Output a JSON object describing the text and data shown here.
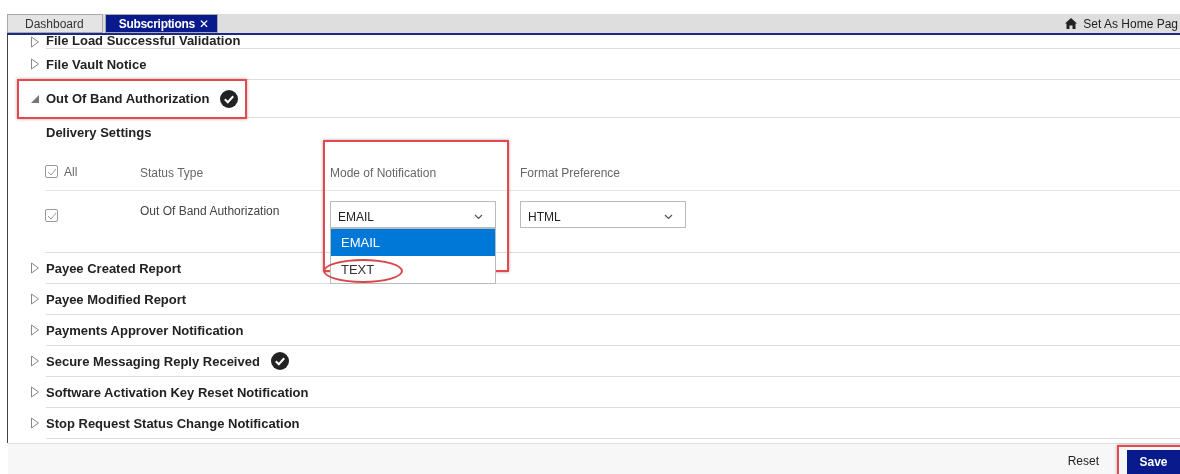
{
  "tabs": [
    {
      "label": "Dashboard",
      "selected": false
    },
    {
      "label": "Subscriptions",
      "selected": true,
      "close": "✕"
    }
  ],
  "set_home": "Set As Home Pag",
  "subscriptions": [
    {
      "name": "File Load Successful Validation",
      "expanded": false,
      "subscribed": false
    },
    {
      "name": "File Vault Notice",
      "expanded": false,
      "subscribed": false
    },
    {
      "name": "Out Of Band Authorization",
      "expanded": true,
      "subscribed": true,
      "highlighted": true,
      "details": {
        "title": "Delivery Settings",
        "all_label": "All",
        "all_checked": true,
        "columns": [
          "Status Type",
          "Mode of Notification",
          "Format Preference"
        ],
        "rows": [
          {
            "checked": true,
            "status_type": "Out Of Band Authorization",
            "mode": {
              "value": "EMAIL",
              "open": true,
              "options": [
                {
                  "label": "EMAIL",
                  "selected": true,
                  "circled": false
                },
                {
                  "label": "TEXT",
                  "selected": false,
                  "circled": true
                }
              ]
            },
            "format": {
              "value": "HTML"
            }
          }
        ]
      }
    },
    {
      "name": "Payee Created Report",
      "expanded": false,
      "subscribed": false
    },
    {
      "name": "Payee Modified Report",
      "expanded": false,
      "subscribed": false
    },
    {
      "name": "Payments Approver Notification",
      "expanded": false,
      "subscribed": false
    },
    {
      "name": "Secure Messaging Reply Received",
      "expanded": false,
      "subscribed": true
    },
    {
      "name": "Software Activation Key Reset Notification",
      "expanded": false,
      "subscribed": false
    },
    {
      "name": "Stop Request Status Change Notification",
      "expanded": false,
      "subscribed": false
    }
  ],
  "footer": {
    "reset": "Reset",
    "save": "Save",
    "save_highlighted": true
  }
}
